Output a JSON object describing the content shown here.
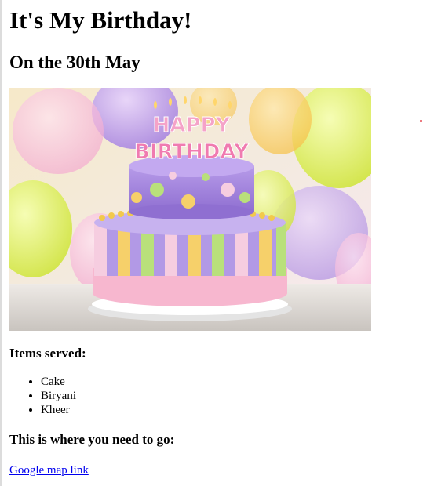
{
  "header": {
    "title": "It's My Birthday!",
    "date_line": "On the 30th May"
  },
  "hero_image": {
    "cake_text_top": "HAPPY",
    "cake_text_bottom": "BIRTHDAY"
  },
  "items": {
    "heading": "Items served:",
    "list": [
      "Cake",
      "Biryani",
      "Kheer"
    ]
  },
  "location": {
    "heading": "This is where you need to go:",
    "link_text": "Google map link"
  },
  "colors": {
    "link": "#0000ee",
    "text": "#000000"
  }
}
